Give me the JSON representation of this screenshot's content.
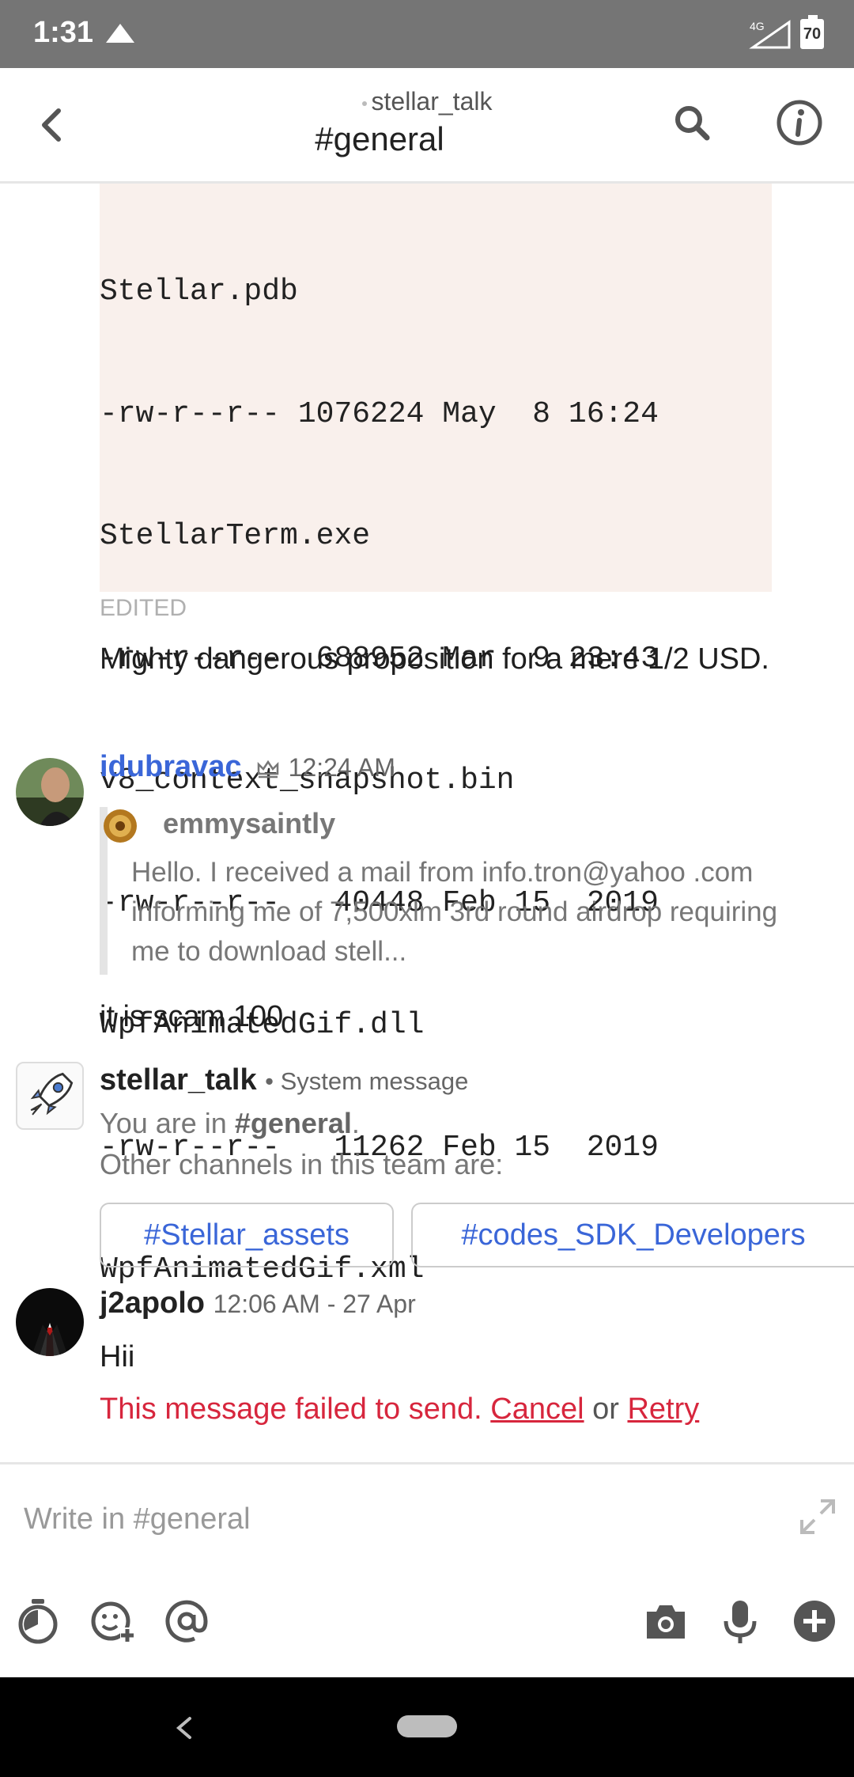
{
  "status_bar": {
    "time": "1:31",
    "network": "4G",
    "battery": "70"
  },
  "header": {
    "team": "stellar_talk",
    "channel": "#general",
    "icons": [
      "back-arrow-icon",
      "search-icon",
      "info-icon"
    ]
  },
  "code_block": {
    "lines": [
      "Stellar.pdb",
      "-rw-r--r-- 1076224 May  8 16:24",
      "StellarTerm.exe",
      "-rw-r--r--  688952 Mar  9 23:43",
      "v8_context_snapshot.bin",
      "-rw-r--r--   40448 Feb 15  2019",
      "WpfAnimatedGif.dll",
      "-rw-r--r--   11262 Feb 15  2019",
      "WpfAnimatedGif.xml"
    ],
    "edited_label": "EDITED"
  },
  "messages": {
    "m1_text": "Mighty dangerous proposition for a mere 1/2 USD.",
    "idubravac": {
      "name": "idubravac",
      "time": "12:24 AM",
      "quote_author": "emmysaintly",
      "quote_text": "Hello. I received a mail from info.tron@yahoo .com informing me of 7,500xlm 3rd round airdrop requiring me to download stell...",
      "reply": "it is scam 100"
    },
    "system": {
      "name": "stellar_talk",
      "tag": "• System message",
      "line1_prefix": "You are in ",
      "line1_channel": "#general",
      "line1_suffix": ".",
      "line2": "Other channels in this team are:",
      "chips": [
        "#Stellar_assets",
        "#codes_SDK_Developers"
      ]
    },
    "j2apolo": {
      "name": "j2apolo",
      "time": "12:06 AM - 27 Apr",
      "text": "Hii",
      "failed_text": "This message failed to send.",
      "cancel": "Cancel",
      "or": "or",
      "retry": "Retry"
    }
  },
  "composer": {
    "placeholder": "Write in #general",
    "tools": [
      "timer-icon",
      "emoji-add-icon",
      "mention-icon",
      "camera-icon",
      "microphone-icon",
      "plus-icon"
    ]
  },
  "colors": {
    "link_blue": "#3a66d8",
    "error_red": "#d7263d",
    "code_bg": "#f9f0ec",
    "status_bar": "#757575"
  }
}
